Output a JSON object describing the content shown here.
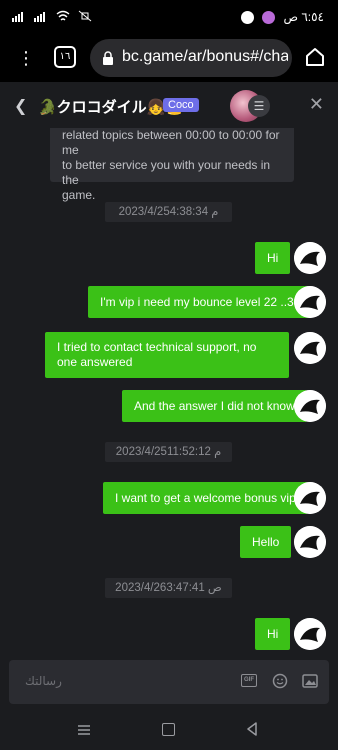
{
  "status_bar": {
    "time": "٦:٥٤ ص"
  },
  "browser": {
    "tab_count": "١٦",
    "url": "bc.game/ar/bonus#/cha"
  },
  "chat_header": {
    "title": "🐊クロコダイル👧👑",
    "badge": "Coco"
  },
  "system_message": {
    "text_line1": "related topics between 00:00 to 00:00 for me",
    "text_line2": "to better service you with your needs in the",
    "text_line3": "game."
  },
  "timestamps": [
    "2023/4/25م 4:38:34",
    "2023/4/25م 11:52:12",
    "2023/4/26ص 3:47:41"
  ],
  "messages": [
    "Hi",
    "I'm vip i need my bounce level 22 ..33",
    "I tried to contact technical support, no one answered",
    "And the answer I did not know",
    "I want to get a welcome bonus vip",
    "Hello",
    "Hi"
  ],
  "input": {
    "placeholder": "رسالتك",
    "gif_label": "GIF"
  },
  "colors": {
    "bubble": "#3bc117",
    "background": "#1b1c1f",
    "badge": "#6e6ee8"
  }
}
